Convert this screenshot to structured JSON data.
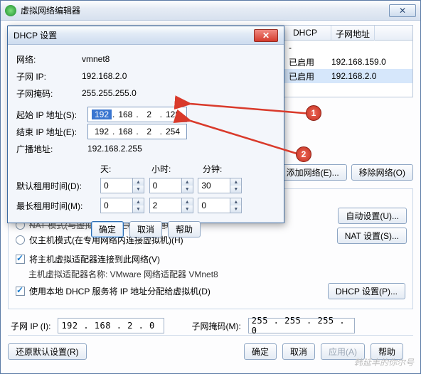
{
  "main": {
    "title": "虚拟网络编辑器",
    "table": {
      "col_dhcp": "DHCP",
      "col_subnet": "子网地址",
      "row1": {
        "dhcp": "-",
        "sub": ""
      },
      "row2": {
        "dhcp": "已启用",
        "sub": "192.168.159.0"
      },
      "row3": {
        "dhcp": "已启用",
        "sub": "192.168.2.0"
      }
    },
    "buttons": {
      "add_net": "添加网络(E)...",
      "remove_net": "移除网络(O)",
      "auto_set": "自动设置(U)...",
      "nat_set": "NAT 设置(S)...",
      "dhcp_set": "DHCP 设置(P)...",
      "restore": "还原默认设置(R)",
      "ok": "确定",
      "cancel": "取消",
      "apply": "应用(A)",
      "help": "帮助"
    },
    "radio_nat": "NAT 模式(与虚拟机共享主机的 IP 地址)(N)",
    "radio_host": "仅主机模式(在专用网络内连接虚拟机)(H)",
    "chk_connect": "将主机虚拟适配器连接到此网络(V)",
    "adapter_line": "主机虚拟适配器名称: VMware 网络适配器 VMnet8",
    "chk_dhcp": "使用本地 DHCP 服务将 IP 地址分配给虚拟机(D)",
    "subnet_ip_lab": "子网 IP (I):",
    "subnet_ip_val": "192 . 168 .  2  .  0",
    "mask_lab": "子网掩码(M):",
    "mask_val": "255 . 255 . 255 .  0"
  },
  "dialog": {
    "title": "DHCP 设置",
    "net_lab": "网络:",
    "net_val": "vmnet8",
    "sub_lab": "子网 IP:",
    "sub_val": "192.168.2.0",
    "msk_lab": "子网掩码:",
    "msk_val": "255.255.255.0",
    "start_lab": "起始 IP 地址(S):",
    "start_oct": {
      "a": "192",
      "b": "168",
      "c": "2",
      "d": "128"
    },
    "end_lab": "结束 IP 地址(E):",
    "end_oct": {
      "a": "192",
      "b": "168",
      "c": "2",
      "d": "254"
    },
    "bcast_lab": "广播地址:",
    "bcast_val": "192.168.2.255",
    "col_day": "天:",
    "col_hour": "小时:",
    "col_min": "分钟:",
    "def_lab": "默认租用时间(D):",
    "def": {
      "d": "0",
      "h": "0",
      "m": "30"
    },
    "max_lab": "最长租用时间(M):",
    "max": {
      "d": "0",
      "h": "2",
      "m": "0"
    },
    "ok": "确定",
    "cancel": "取消",
    "help": "帮助"
  },
  "annot": {
    "one": "1",
    "two": "2"
  },
  "watermark": "韩延丰的你尔号"
}
